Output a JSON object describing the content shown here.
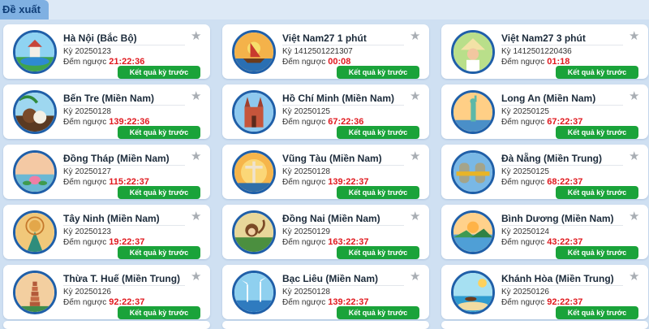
{
  "tab": {
    "label": "Đề xuất"
  },
  "button_label": "Kết quả kỳ trước",
  "countdown_label": "Đếm ngược",
  "colors": {
    "accent_red": "#e0191f",
    "button_green": "#1aa33a",
    "tab_blue": "#7fb0e2"
  },
  "cards": [
    {
      "name": "Hà Nội (Bắc Bộ)",
      "ky": "Kỳ 20250123",
      "countdown": "21:22:36",
      "icon": "hanoi-pagoda-icon"
    },
    {
      "name": "Việt Nam27 1 phút",
      "ky": "Kỳ 1412501221307",
      "countdown": "00:08",
      "icon": "boat-temple-icon"
    },
    {
      "name": "Việt Nam27 3 phút",
      "ky": "Kỳ 1412501220436",
      "countdown": "01:18",
      "icon": "conical-hat-woman-icon"
    },
    {
      "name": "Bến Tre (Miền Nam)",
      "ky": "Kỳ 20250128",
      "countdown": "139:22:36",
      "icon": "coconut-icon"
    },
    {
      "name": "Hồ Chí Minh (Miền Nam)",
      "ky": "Kỳ 20250125",
      "countdown": "67:22:36",
      "icon": "cathedral-icon"
    },
    {
      "name": "Long An (Miền Nam)",
      "ky": "Kỳ 20250125",
      "countdown": "67:22:37",
      "icon": "statue-icon"
    },
    {
      "name": "Đồng Tháp (Miền Nam)",
      "ky": "Kỳ 20250127",
      "countdown": "115:22:37",
      "icon": "lotus-icon"
    },
    {
      "name": "Vũng Tàu (Miền Nam)",
      "ky": "Kỳ 20250128",
      "countdown": "139:22:37",
      "icon": "christ-statue-icon"
    },
    {
      "name": "Đà Nẵng (Miền Trung)",
      "ky": "Kỳ 20250125",
      "countdown": "68:22:37",
      "icon": "golden-hands-bridge-icon"
    },
    {
      "name": "Tây Ninh (Miền Nam)",
      "ky": "Kỳ 20250123",
      "countdown": "19:22:37",
      "icon": "goddess-icon"
    },
    {
      "name": "Đồng Nai (Miền Nam)",
      "ky": "Kỳ 20250129",
      "countdown": "163:22:37",
      "icon": "monkey-icon"
    },
    {
      "name": "Bình Dương (Miền Nam)",
      "ky": "Kỳ 20250124",
      "countdown": "43:22:37",
      "icon": "river-landscape-icon"
    },
    {
      "name": "Thừa T. Huế (Miền Trung)",
      "ky": "Kỳ 20250126",
      "countdown": "92:22:37",
      "icon": "thien-mu-pagoda-icon"
    },
    {
      "name": "Bạc Liêu (Miền Nam)",
      "ky": "Kỳ 20250128",
      "countdown": "139:22:37",
      "icon": "wind-turbine-icon"
    },
    {
      "name": "Khánh Hòa (Miền Trung)",
      "ky": "Kỳ 20250126",
      "countdown": "92:22:37",
      "icon": "beach-boat-icon"
    }
  ]
}
